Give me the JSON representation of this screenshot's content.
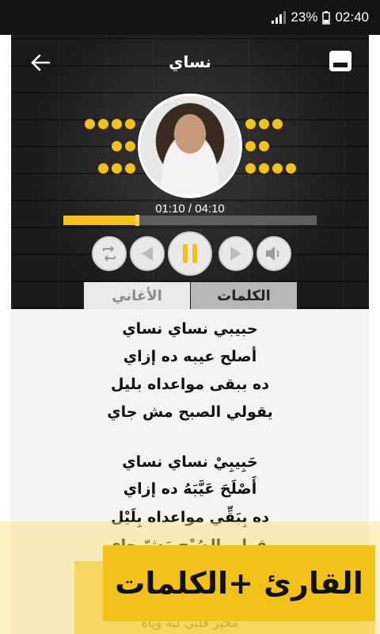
{
  "status_bar": {
    "battery": "23%",
    "time": "02:40"
  },
  "header": {
    "title": "نساي"
  },
  "player": {
    "current_time": "01:10",
    "total_time": "04:10",
    "time_text": "01:10 / 04:10",
    "progress": 0.29
  },
  "tabs": [
    {
      "label": "الكلمات",
      "active": true
    },
    {
      "label": "الأغاني",
      "active": false
    }
  ],
  "lyrics": [
    "حبيبي نساي نساي",
    "أصلح عيبه ده إزاي",
    "ده ببقى مواعداه بليل",
    "يقولي الصبح مش جاي",
    "حَبِيبِيْ نساي نساي",
    "أَصْلَحَ عَيَّبَهُ ده إزاي",
    "ده بِبَقِّي مواعداه بِلَيْل",
    "يقولي الصُبْح مَشّ جاي",
    "محير قلبي ليه وياه"
  ],
  "banner": {
    "text": "القارئ +الكلمات"
  },
  "colors": {
    "accent": "#f3c21a",
    "dark": "#1d1d1d"
  }
}
